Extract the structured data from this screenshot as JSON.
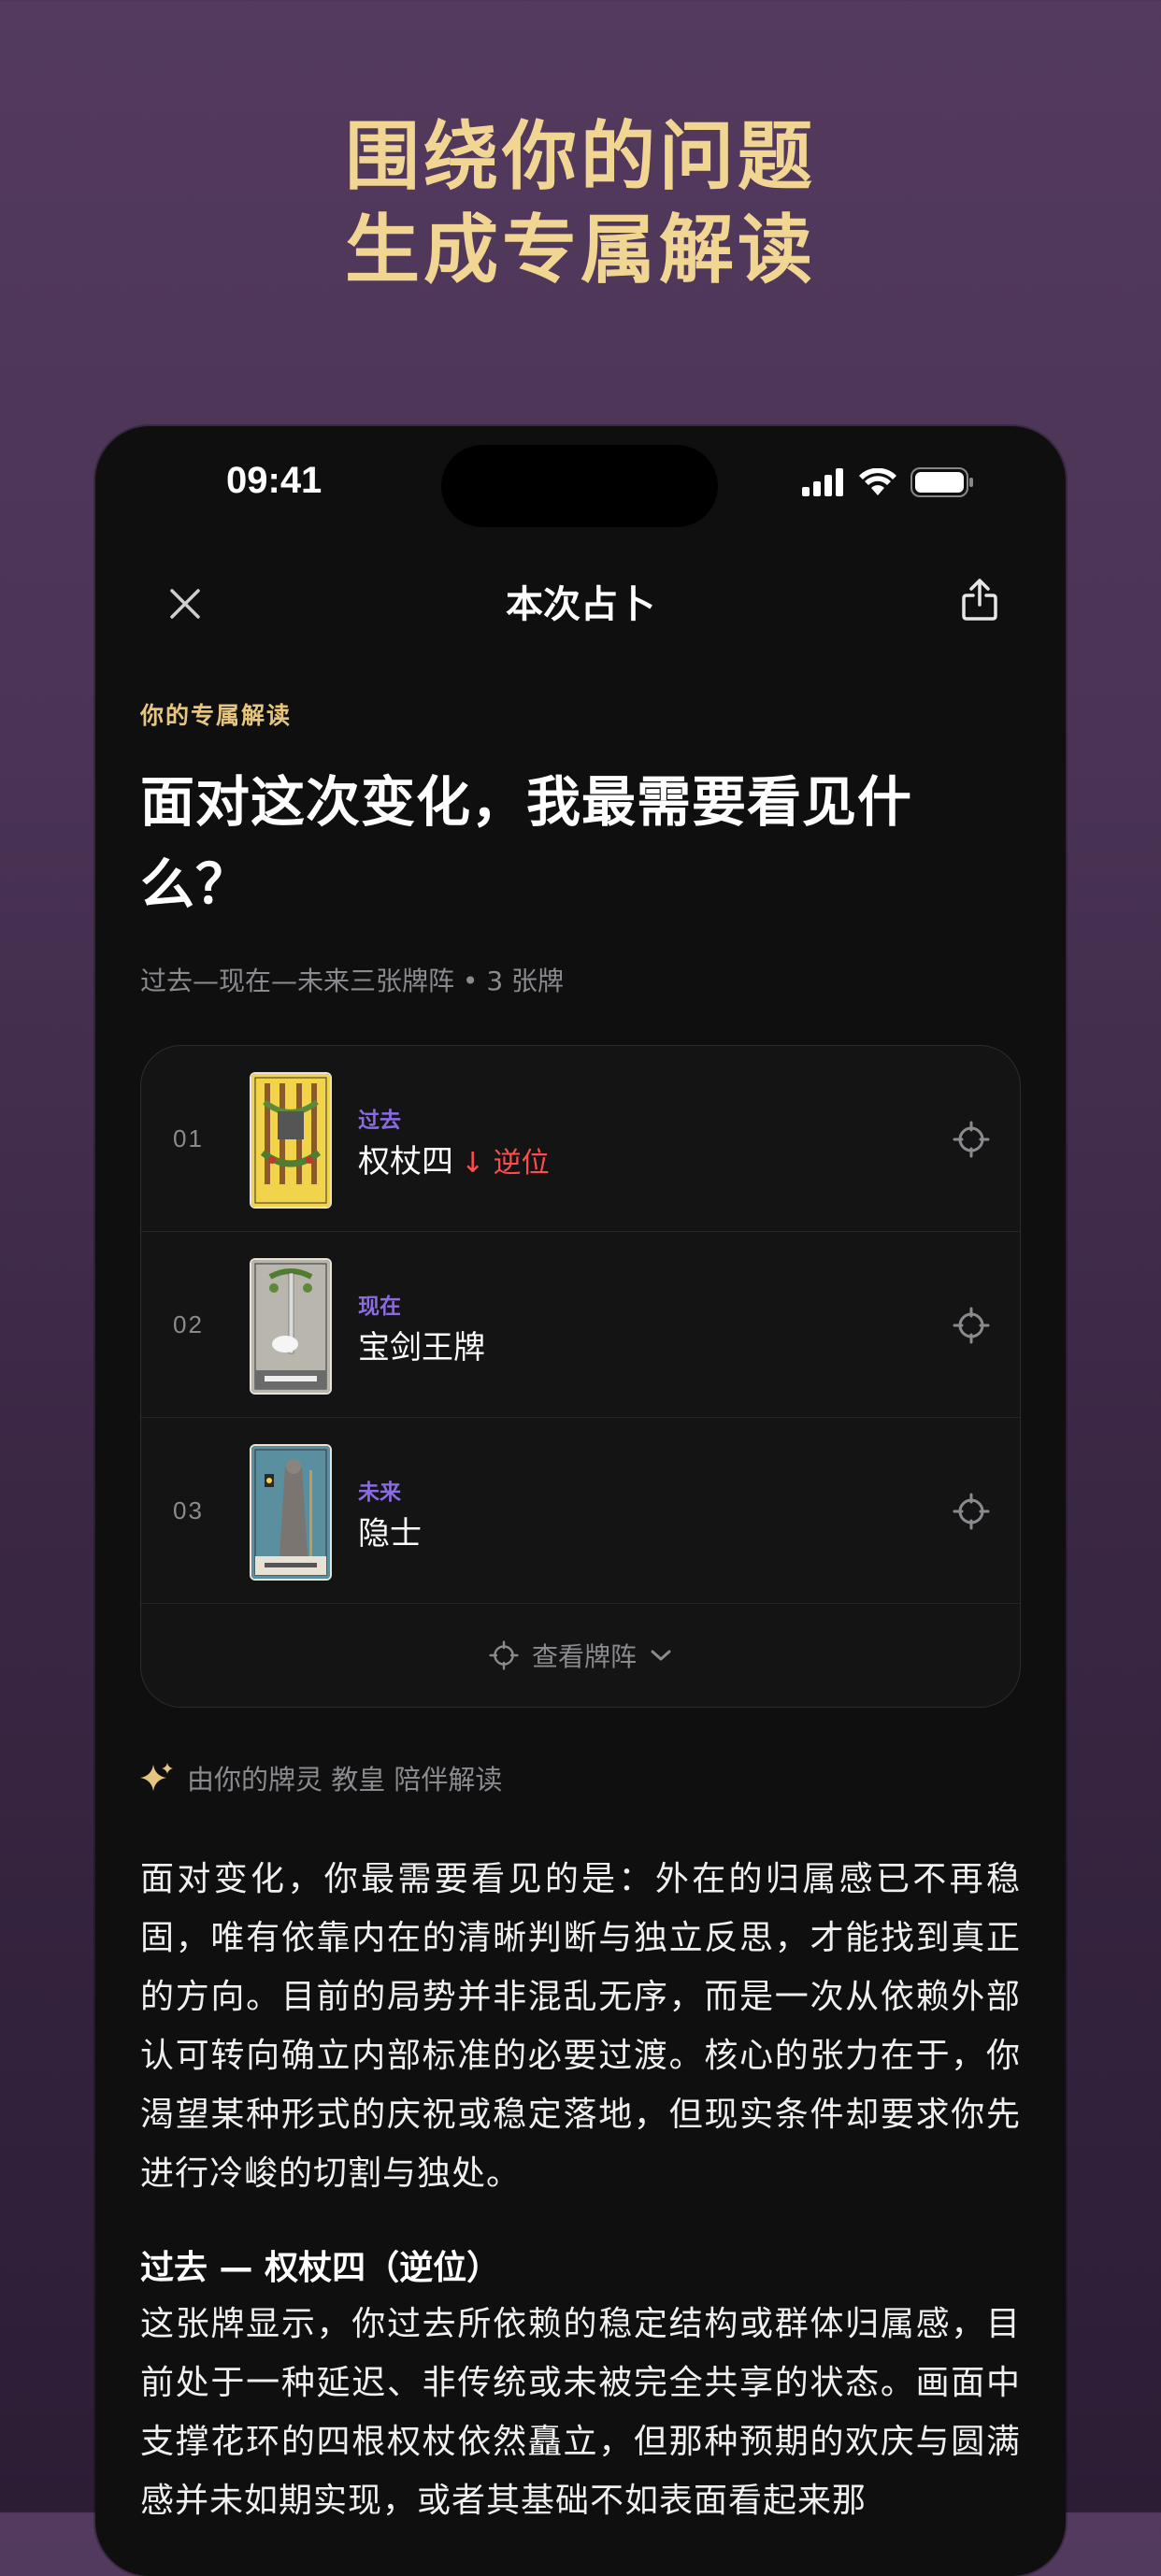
{
  "headline": {
    "line1": "围绕你的问题",
    "line2": "生成专属解读"
  },
  "status_bar": {
    "time": "09:41"
  },
  "topbar": {
    "title": "本次占卜"
  },
  "reading": {
    "eyebrow": "你的专属解读",
    "question": "面对这次变化，我最需要看见什么？",
    "spread_meta": "过去—现在—未来三张牌阵 • 3 张牌"
  },
  "cards": [
    {
      "num": "01",
      "position": "过去",
      "name": "权杖四",
      "reversed_label": "↓ 逆位"
    },
    {
      "num": "02",
      "position": "现在",
      "name": "宝剑王牌",
      "reversed_label": ""
    },
    {
      "num": "03",
      "position": "未来",
      "name": "隐士",
      "reversed_label": ""
    }
  ],
  "view_spread_label": "查看牌阵",
  "companion_label": "由你的牌灵 教皇 陪伴解读",
  "interpretation": {
    "summary": "面对变化，你最需要看见的是：外在的归属感已不再稳固，唯有依靠内在的清晰判断与独立反思，才能找到真正的方向。目前的局势并非混乱无序，而是一次从依赖外部认可转向确立内部标准的必要过渡。核心的张力在于，你渴望某种形式的庆祝或稳定落地，但现实条件却要求你先进行冷峻的切割与独处。",
    "past_title": "过去 — 权杖四（逆位）",
    "past_text": "这张牌显示，你过去所依赖的稳定结构或群体归属感，目前处于一种延迟、非传统或未被完全共享的状态。画面中支撑花环的四根权杖依然矗立，但那种预期的欢庆与圆满感并未如期实现，或者其基础不如表面看起来那"
  },
  "colors": {
    "accent_gold": "#f0d593",
    "position_purple": "#8b6be0",
    "reversed_red": "#ff4d4d"
  },
  "icons": [
    "close-icon",
    "share-icon",
    "target-icon",
    "sparkle-icon",
    "chevron-down-icon",
    "signal-icon",
    "wifi-icon",
    "battery-icon"
  ]
}
